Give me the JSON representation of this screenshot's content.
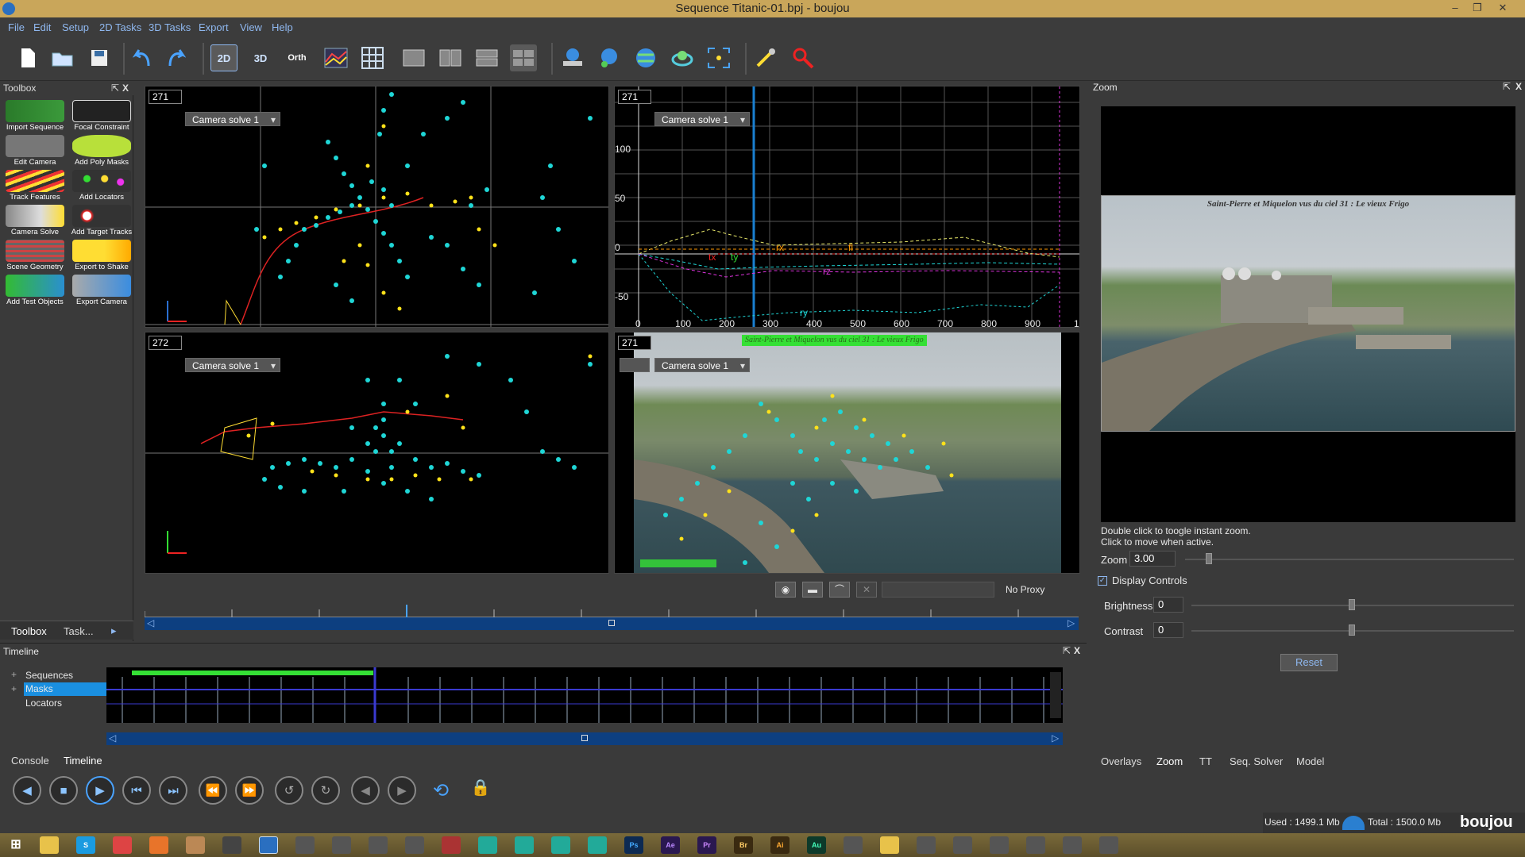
{
  "window": {
    "title": "Sequence Titanic-01.bpj - boujou"
  },
  "menu": [
    "File",
    "Edit",
    "Setup",
    "2D Tasks",
    "3D Tasks",
    "Export",
    "View",
    "Help"
  ],
  "toolbar": {
    "btn_2d": "2D",
    "btn_3d": "3D",
    "btn_orth": "Orth"
  },
  "toolbox": {
    "title": "Toolbox",
    "tools": [
      "Import Sequence",
      "Focal Constraint",
      "Edit Camera",
      "Add Poly Masks",
      "Track Features",
      "Add Locators",
      "Camera Solve",
      "Add Target Tracks",
      "Scene Geometry",
      "Export to Shake",
      "Add Test Objects",
      "Export Camera"
    ],
    "tabs": [
      "Toolbox",
      "Task..."
    ]
  },
  "viewports": {
    "tl": {
      "frame": "271",
      "camera": "Camera solve 1"
    },
    "tr": {
      "frame": "271",
      "camera": "Camera solve 1"
    },
    "bl": {
      "frame": "272",
      "camera": "Camera solve 1"
    },
    "br": {
      "frame": "271",
      "camera": "Camera solve 1",
      "caption": "Saint-Pierre et Miquelon vus du ciel 31 : Le vieux Frigo"
    }
  },
  "graph": {
    "y_ticks": [
      "100",
      "50",
      "0",
      "-50"
    ],
    "x_ticks": [
      "0",
      "100",
      "200",
      "300",
      "400",
      "500",
      "600",
      "700",
      "800",
      "900",
      "1"
    ],
    "series_labels": [
      "tx",
      "ty",
      "rx",
      "rz",
      "ry",
      "fl"
    ]
  },
  "proxy": {
    "label": "No Proxy"
  },
  "timeline": {
    "title": "Timeline",
    "tree": [
      "Sequences",
      "Masks",
      "Locators"
    ],
    "tabs": [
      "Console",
      "Timeline"
    ]
  },
  "zoom": {
    "title": "Zoom",
    "caption": "Saint-Pierre et Miquelon vus du ciel 31 : Le vieux Frigo",
    "help1": "Double click to toogle instant zoom.",
    "help2": "Click to move when active.",
    "zoom_label": "Zoom",
    "zoom_value": "3.00",
    "display_controls": "Display Controls",
    "brightness_label": "Brightness",
    "brightness_value": "0",
    "contrast_label": "Contrast",
    "contrast_value": "0",
    "reset": "Reset",
    "tabs": [
      "Overlays",
      "Zoom",
      "TT",
      "Seq. Solver",
      "Model"
    ]
  },
  "status": {
    "used": "Used : 1499.1 Mb",
    "total": "Total : 1500.0 Mb",
    "brand": "boujou"
  },
  "colors": {
    "accent": "#8fb8f0",
    "track_cyan": "#1fd6d6",
    "track_yellow": "#ffe21a",
    "timeline_blue": "#0d3f80",
    "progress_green": "#35e035"
  }
}
